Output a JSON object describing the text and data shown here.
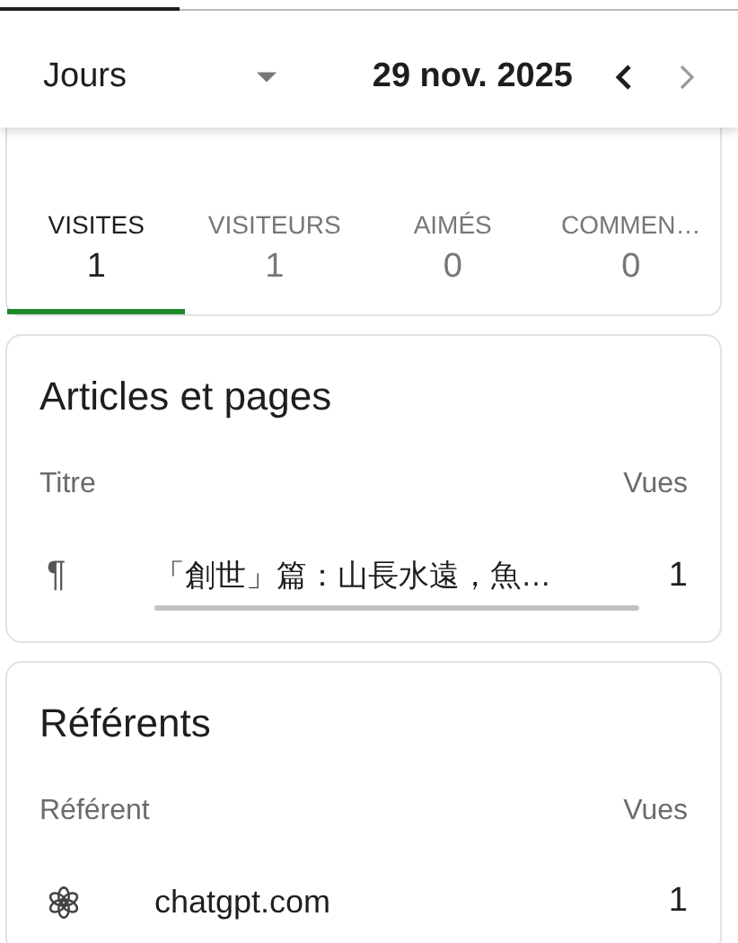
{
  "period_selector": {
    "value": "Jours"
  },
  "date": "29 nov. 2025",
  "nav": [
    {
      "kind": "prev",
      "disabled": false
    },
    {
      "kind": "next",
      "disabled": true
    }
  ],
  "tabs": [
    {
      "label": "VISITES",
      "value": "1",
      "selected": true
    },
    {
      "label": "VISITEURS",
      "value": "1",
      "selected": false
    },
    {
      "label": "AIMÉS",
      "value": "0",
      "selected": false
    },
    {
      "label": "COMMEN…",
      "value": "0",
      "selected": false
    }
  ],
  "cards": [
    {
      "title": "Articles et pages",
      "columns": [
        "Titre",
        "Vues"
      ],
      "rows": [
        {
          "kind": "page",
          "icon": "¶",
          "label": "「創世」篇：山長水遠，魚…",
          "views": "1"
        }
      ]
    },
    {
      "title": "Référents",
      "columns": [
        "Référent",
        "Vues"
      ],
      "rows": [
        {
          "kind": "site",
          "label": "chatgpt.com",
          "views": "1"
        }
      ]
    }
  ]
}
